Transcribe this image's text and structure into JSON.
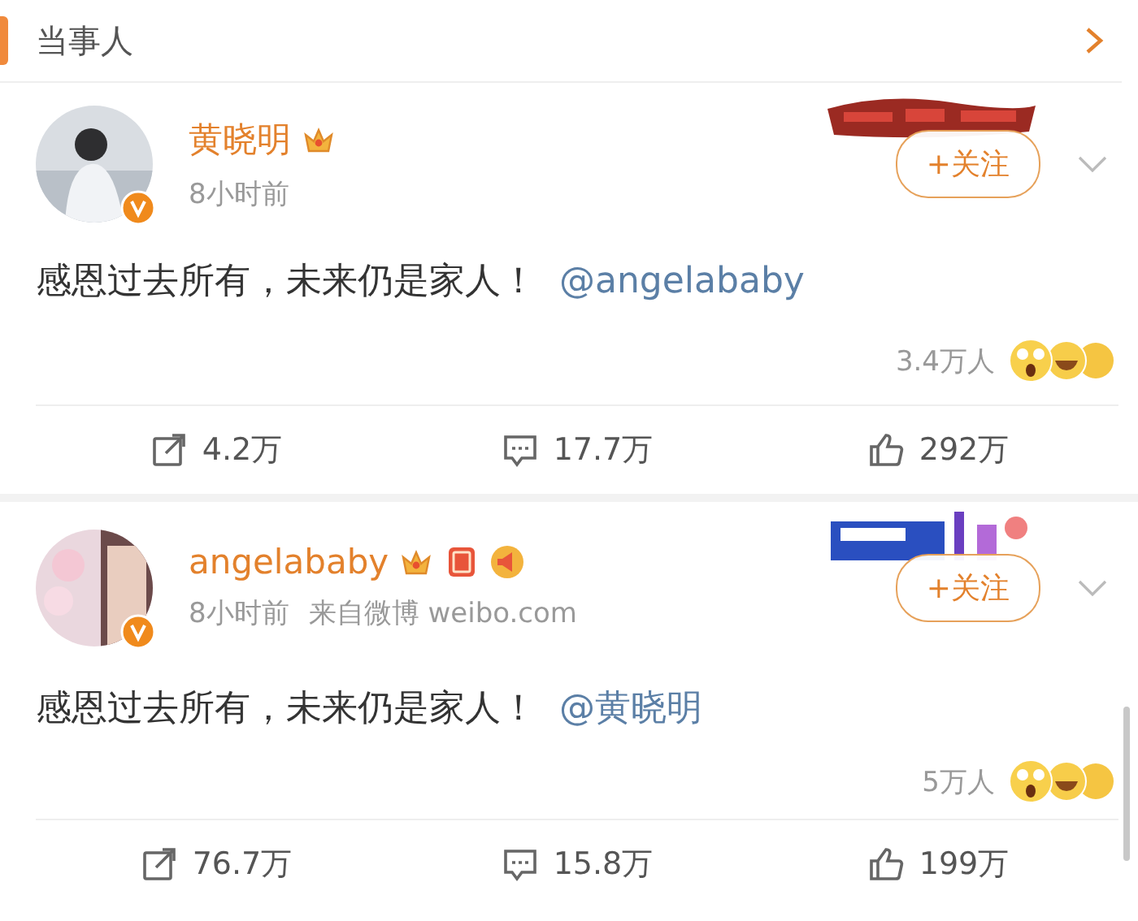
{
  "section": {
    "title": "当事人"
  },
  "posts": [
    {
      "author": "黄晓明",
      "verified": true,
      "badges": [
        {
          "kind": "crown"
        }
      ],
      "time": "8小时前",
      "text": "感恩过去所有，未来仍是家人！",
      "mention": "@angelababy",
      "follow": "+关注",
      "reactions": "3.4万人",
      "actions": [
        {
          "kind": "share",
          "count": "4.2万"
        },
        {
          "kind": "comment",
          "count": "17.7万"
        },
        {
          "kind": "like",
          "count": "292万"
        }
      ]
    },
    {
      "author": "angelababy",
      "verified": true,
      "badges": [
        {
          "kind": "crown"
        },
        {
          "kind": "fu"
        },
        {
          "kind": "horn"
        }
      ],
      "time": "8小时前",
      "source": "来自微博 weibo.com",
      "text": "感恩过去所有，未来仍是家人！",
      "mention": "@黄晓明",
      "follow": "+关注",
      "reactions": "5万人",
      "actions": [
        {
          "kind": "share",
          "count": "76.7万"
        },
        {
          "kind": "comment",
          "count": "15.8万"
        },
        {
          "kind": "like",
          "count": "199万"
        }
      ]
    }
  ]
}
